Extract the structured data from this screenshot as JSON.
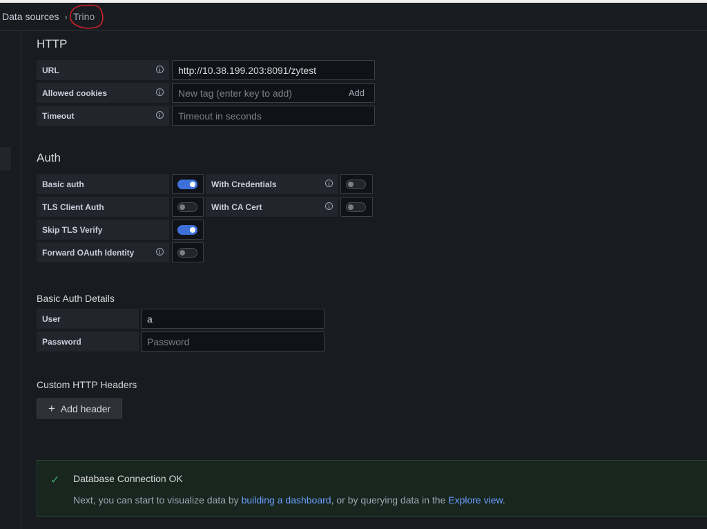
{
  "breadcrumb": {
    "parent": "Data sources",
    "separator": "›",
    "current": "Trino"
  },
  "http": {
    "title": "HTTP",
    "url_label": "URL",
    "url_value": "http://10.38.199.203:8091/zytest",
    "cookies_label": "Allowed cookies",
    "cookies_placeholder": "New tag (enter key to add)",
    "cookies_add": "Add",
    "timeout_label": "Timeout",
    "timeout_placeholder": "Timeout in seconds"
  },
  "auth": {
    "title": "Auth",
    "basic_auth": {
      "label": "Basic auth",
      "on": true
    },
    "with_credentials": {
      "label": "With Credentials",
      "on": false
    },
    "tls_client_auth": {
      "label": "TLS Client Auth",
      "on": false
    },
    "with_ca_cert": {
      "label": "With CA Cert",
      "on": false
    },
    "skip_tls_verify": {
      "label": "Skip TLS Verify",
      "on": true
    },
    "forward_oauth": {
      "label": "Forward OAuth Identity",
      "on": false
    }
  },
  "basic_auth_details": {
    "title": "Basic Auth Details",
    "user_label": "User",
    "user_value": "a",
    "password_label": "Password",
    "password_placeholder": "Password"
  },
  "custom_headers": {
    "title": "Custom HTTP Headers",
    "add_button": "Add header"
  },
  "alert": {
    "title": "Database Connection OK",
    "text_before": "Next, you can start to visualize data by ",
    "link_dashboard": "building a dashboard",
    "text_middle": ", or by querying data in the ",
    "link_explore": "Explore view",
    "text_after": "."
  },
  "colors": {
    "background": "#181b1f",
    "accent_toggle": "#3d71d9",
    "success": "#3fa96c",
    "link": "#6e9fff",
    "annotation": "#d0202a"
  }
}
